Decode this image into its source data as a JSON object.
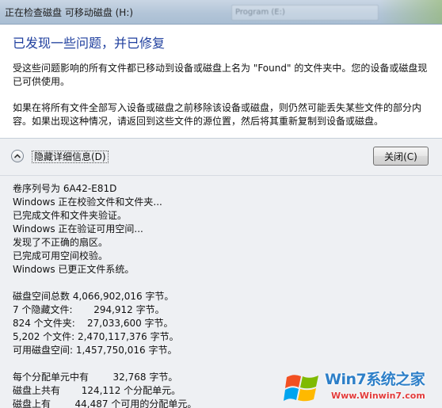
{
  "window": {
    "title": "正在检查磁盘 可移动磁盘 (H:)",
    "behind_title": "Program (E:)"
  },
  "content": {
    "headline": "已发现一些问题，并已修复",
    "para1": "受这些问题影响的所有文件都已移动到设备或磁盘上名为 \"Found\" 的文件夹中。您的设备或磁盘现已可供使用。",
    "para2": "如果在将所有文件全部写入设备或磁盘之前移除该设备或磁盘，则仍然可能丢失某些文件的部分内容。如果出现这种情况，请返回到这些文件的源位置，然后将其重新复制到设备或磁盘。"
  },
  "details": {
    "toggle_label": "隐藏详细信息(D)",
    "close_label": "关闭(C)",
    "log": [
      "卷序列号为 6A42-E81D",
      "Windows 正在校验文件和文件夹...",
      "已完成文件和文件夹验证。",
      "Windows 正在验证可用空间...",
      "发现了不正确的扇区。",
      "已完成可用空间校验。",
      "Windows 已更正文件系统。",
      "",
      "磁盘空间总数 4,066,902,016 字节。",
      "7 个隐藏文件:       294,912 字节。",
      "824 个文件夹:    27,033,600 字节。",
      "5,202 个文件: 2,470,117,376 字节。",
      "可用磁盘空间: 1,457,750,016 字节。",
      "",
      "每个分配单元中有        32,768 字节。",
      "磁盘上共有       124,112 个分配单元。",
      "磁盘上有        44,487 个可用的分配单元。"
    ]
  },
  "watermark": {
    "brand": "Win7系统之家",
    "url": "Www.Winwin7.com"
  },
  "colors": {
    "headline": "#1f3f9e",
    "titlebar": "#b3c5d8",
    "panel": "#eef0f3"
  }
}
